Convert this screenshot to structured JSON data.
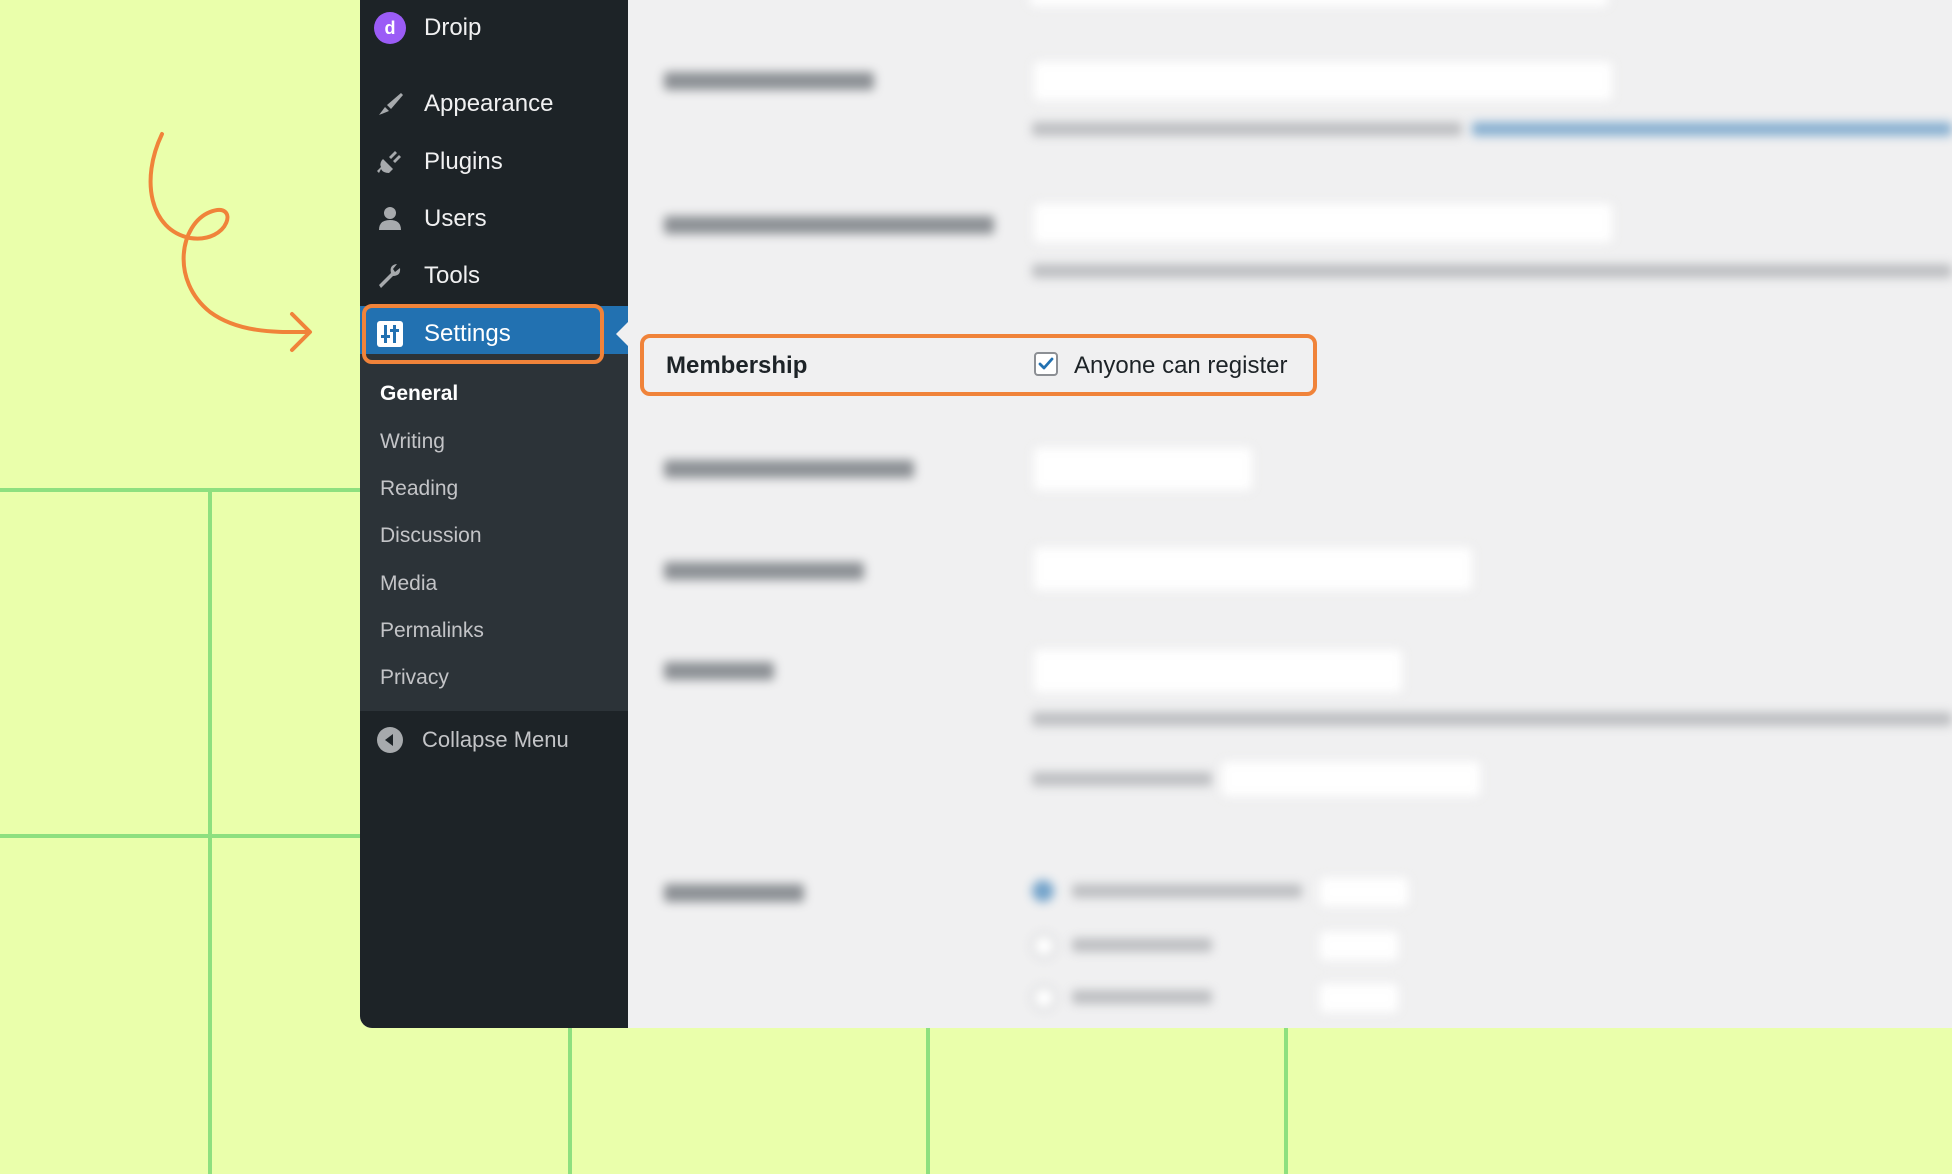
{
  "brand": {
    "name": "Droip",
    "logo_letter": "d",
    "logo_color": "#9b5cf6"
  },
  "menu": [
    {
      "label": "Appearance",
      "icon": "brush-icon"
    },
    {
      "label": "Plugins",
      "icon": "plug-icon"
    },
    {
      "label": "Users",
      "icon": "user-icon"
    },
    {
      "label": "Tools",
      "icon": "wrench-icon"
    },
    {
      "label": "Settings",
      "icon": "sliders-icon",
      "active": true
    }
  ],
  "submenu": [
    "General",
    "Writing",
    "Reading",
    "Discussion",
    "Media",
    "Permalinks",
    "Privacy"
  ],
  "submenu_current": "General",
  "collapse_label": "Collapse Menu",
  "membership": {
    "label": "Membership",
    "checkbox_label": "Anyone can register",
    "checked": true
  },
  "colors": {
    "sidebar": "#1d2327",
    "active": "#2271b1",
    "highlight": "#f0833a",
    "background": "#eaffab",
    "grid": "#8ee07f"
  }
}
